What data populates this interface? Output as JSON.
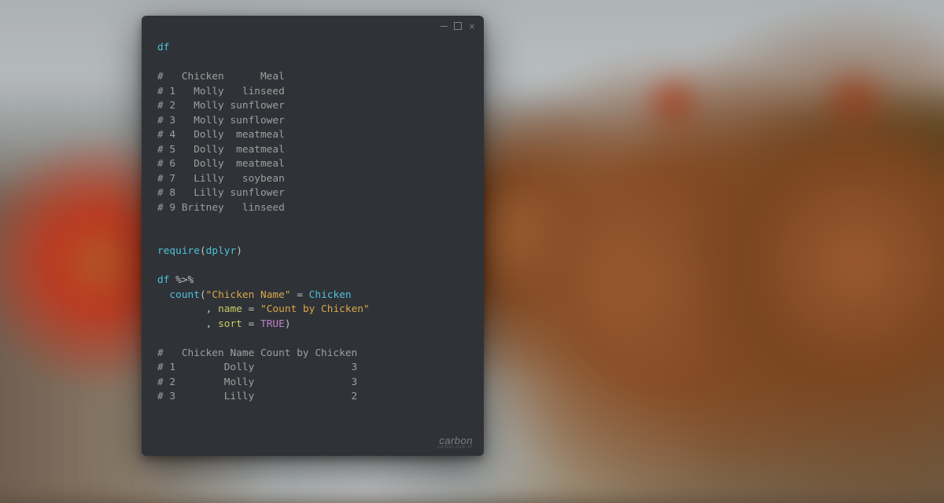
{
  "window": {
    "close_glyph": "×"
  },
  "code": {
    "l1_var": "df",
    "l3": "#   Chicken      Meal",
    "l4": "# 1   Molly   linseed",
    "l5": "# 2   Molly sunflower",
    "l6": "# 3   Molly sunflower",
    "l7": "# 4   Dolly  meatmeal",
    "l8": "# 5   Dolly  meatmeal",
    "l9": "# 6   Dolly  meatmeal",
    "l10": "# 7   Lilly   soybean",
    "l11": "# 8   Lilly sunflower",
    "l12": "# 9 Britney   linseed",
    "require_fn": "require",
    "require_arg": "dplyr",
    "pipe_var": "df",
    "pipe_op": " %>%",
    "count_indent": "  ",
    "count_fn": "count",
    "count_p_open": "(",
    "count_str1": "\"Chicken Name\"",
    "count_eq1": " = ",
    "count_id1": "Chicken",
    "arg_indent": "        ",
    "comma": ", ",
    "name_kw": "name",
    "eq": " = ",
    "name_val": "\"Count by Chicken\"",
    "sort_kw": "sort",
    "sort_val": "TRUE",
    "count_p_close": ")",
    "r1": "#   Chicken Name Count by Chicken",
    "r2": "# 1        Dolly                3",
    "r3": "# 2        Molly                3",
    "r4": "# 3        Lilly                2"
  },
  "watermark": {
    "main": "carbon",
    "sub": "carbon.now.sh"
  }
}
